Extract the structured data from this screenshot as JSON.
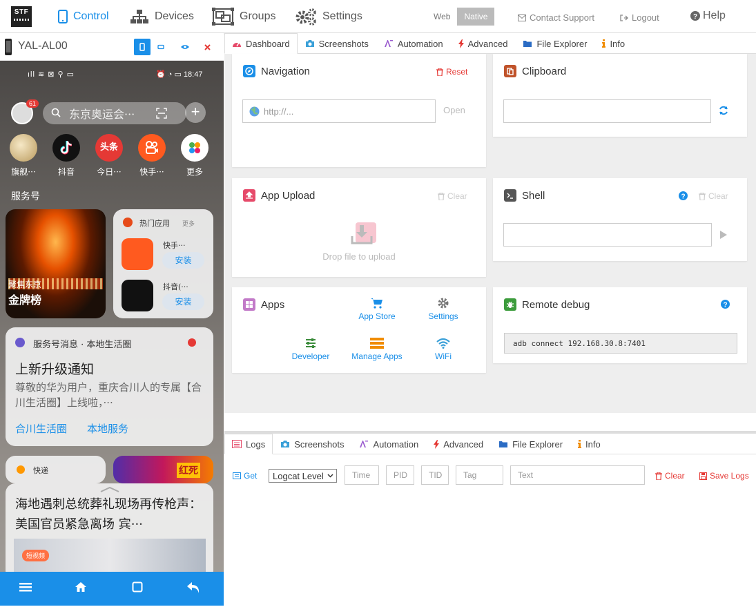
{
  "header": {
    "logo_text": "STF",
    "nav": [
      {
        "label": "Control",
        "icon": "mobile-icon",
        "active": true
      },
      {
        "label": "Devices",
        "icon": "sitemap-icon",
        "active": false
      },
      {
        "label": "Groups",
        "icon": "object-group-icon",
        "active": false
      },
      {
        "label": "Settings",
        "icon": "gears-icon",
        "active": false
      }
    ],
    "mode_web": "Web",
    "mode_native": "Native",
    "contact_support": "Contact Support",
    "logout": "Logout",
    "help": "Help"
  },
  "device": {
    "name": "YAL-AL00",
    "screen": {
      "status_time": "18:47",
      "avatar_badge": "61",
      "search_placeholder": "东京奥运会···",
      "apps": [
        {
          "label": "旗舰···"
        },
        {
          "label": "抖音"
        },
        {
          "label": "今日···"
        },
        {
          "label": "快手···"
        },
        {
          "label": "更多"
        }
      ],
      "section_label": "服务号",
      "card1_subtitle": "聚焦东京",
      "card1_title": "金牌榜",
      "popular_title": "热门应用",
      "popular_more": "更多",
      "popular_app1": "快手···",
      "popular_app2": "抖音(···",
      "install_label": "安装",
      "notice_source": "服务号消息 · 本地生活圈",
      "notice_title": "上新升级通知",
      "notice_body": "尊敬的华为用户，重庆合川人的专属【合川生活圈】上线啦，···",
      "notice_link1": "合川生活圈",
      "notice_link2": "本地服务",
      "express_label": "快递",
      "tile_banner": "红死",
      "news_text": "海地遇刺总统葬礼现场再传枪声：美国官员紧急离场 宾···",
      "news_tag": "短视频"
    }
  },
  "tabs": [
    {
      "label": "Dashboard",
      "icon": "dashboard-icon",
      "active": true
    },
    {
      "label": "Screenshots",
      "icon": "camera-icon",
      "active": false
    },
    {
      "label": "Automation",
      "icon": "magic-icon",
      "active": false
    },
    {
      "label": "Advanced",
      "icon": "bolt-icon",
      "active": false
    },
    {
      "label": "File Explorer",
      "icon": "folder-icon",
      "active": false
    },
    {
      "label": "Info",
      "icon": "info-icon",
      "active": false
    }
  ],
  "widgets": {
    "navigation": {
      "title": "Navigation",
      "reset": "Reset",
      "url_placeholder": "http://...",
      "open": "Open"
    },
    "clipboard": {
      "title": "Clipboard"
    },
    "upload": {
      "title": "App Upload",
      "clear": "Clear",
      "drop_text": "Drop file to upload"
    },
    "shell": {
      "title": "Shell",
      "clear": "Clear"
    },
    "apps": {
      "title": "Apps",
      "items": [
        "App Store",
        "Settings",
        "Developer",
        "Manage Apps",
        "WiFi"
      ]
    },
    "remote_debug": {
      "title": "Remote debug",
      "command": "adb connect 192.168.30.8:7401"
    }
  },
  "log_tabs": [
    {
      "label": "Logs",
      "icon": "list-icon",
      "active": true
    },
    {
      "label": "Screenshots",
      "icon": "camera-icon",
      "active": false
    },
    {
      "label": "Automation",
      "icon": "magic-icon",
      "active": false
    },
    {
      "label": "Advanced",
      "icon": "bolt-icon",
      "active": false
    },
    {
      "label": "File Explorer",
      "icon": "folder-icon",
      "active": false
    },
    {
      "label": "Info",
      "icon": "info-icon",
      "active": false
    }
  ],
  "logs": {
    "get": "Get",
    "level": "Logcat Level",
    "time": "Time",
    "pid": "PID",
    "tid": "TID",
    "tag": "Tag",
    "text": "Text",
    "clear": "Clear",
    "save": "Save Logs"
  },
  "colors": {
    "accent": "#1a8fe8",
    "danger": "#e53935",
    "active_btn": "#1a8fe8"
  }
}
